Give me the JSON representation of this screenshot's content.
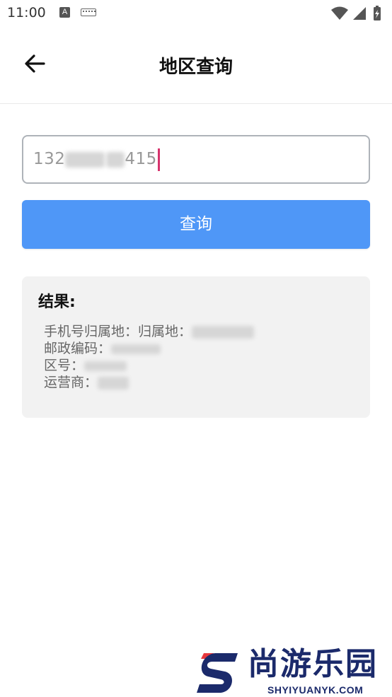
{
  "status_bar": {
    "time": "11:00",
    "notification_icon": "a-icon",
    "keyboard_icon": "keyboard-icon",
    "wifi_icon": "wifi-icon",
    "signal_icon": "signal-icon",
    "battery_icon": "battery-icon"
  },
  "app_bar": {
    "back_icon": "arrow-left-icon",
    "title": "地区查询"
  },
  "search": {
    "value_prefix": "132",
    "value_suffix": "415"
  },
  "query_button": {
    "label": "查询"
  },
  "result": {
    "title": "结果:",
    "lines": [
      {
        "label": "手机号归属地：归属地：",
        "value_hidden": true
      },
      {
        "label": "邮政编码：",
        "value_hidden": true
      },
      {
        "label": "区号：",
        "value_hidden": true
      },
      {
        "label": "运营商：",
        "value_hidden": true
      }
    ]
  },
  "watermark": {
    "cn": "尚游乐园",
    "en": "SHYIYUANYK.COM"
  },
  "colors": {
    "accent": "#4f97f7",
    "caret": "#d6336c",
    "card_bg": "#f2f2f2",
    "watermark": "#1b2a6b"
  }
}
